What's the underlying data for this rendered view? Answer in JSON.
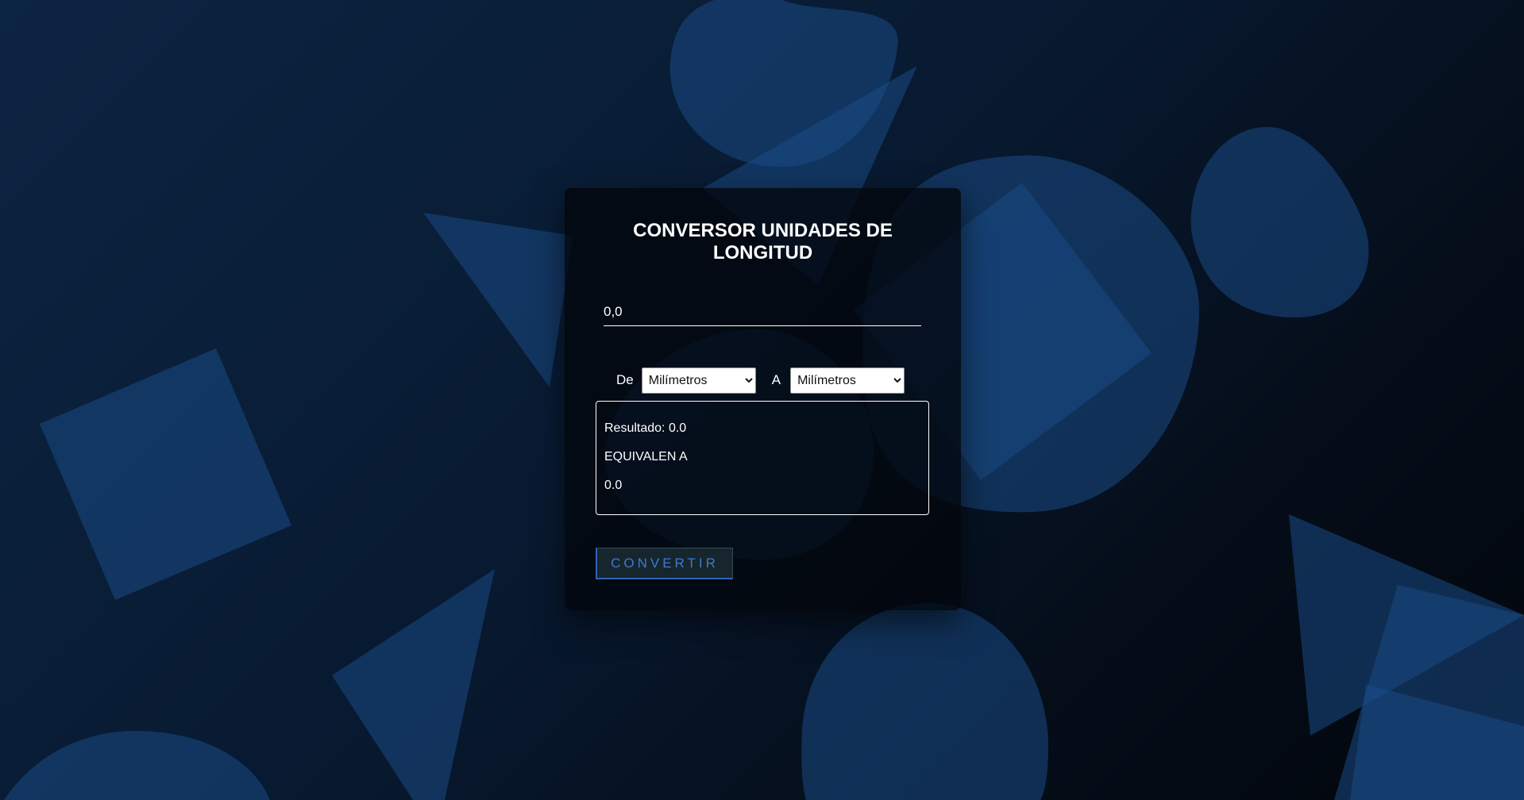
{
  "converter": {
    "title": "CONVERSOR UNIDADES DE LONGITUD",
    "input_value": "0,0",
    "from_label": "De",
    "to_label": "A",
    "from_unit": "Milímetros",
    "to_unit": "Milímetros",
    "result": {
      "line1": "Resultado: 0.0",
      "line2": "EQUIVALEN A",
      "line3": "0.0"
    },
    "convert_button": "CONVERTIR"
  },
  "colors": {
    "shape_fill": "#1a4a85",
    "button_text": "#3a7ad6",
    "button_border": "#2e64b8"
  }
}
